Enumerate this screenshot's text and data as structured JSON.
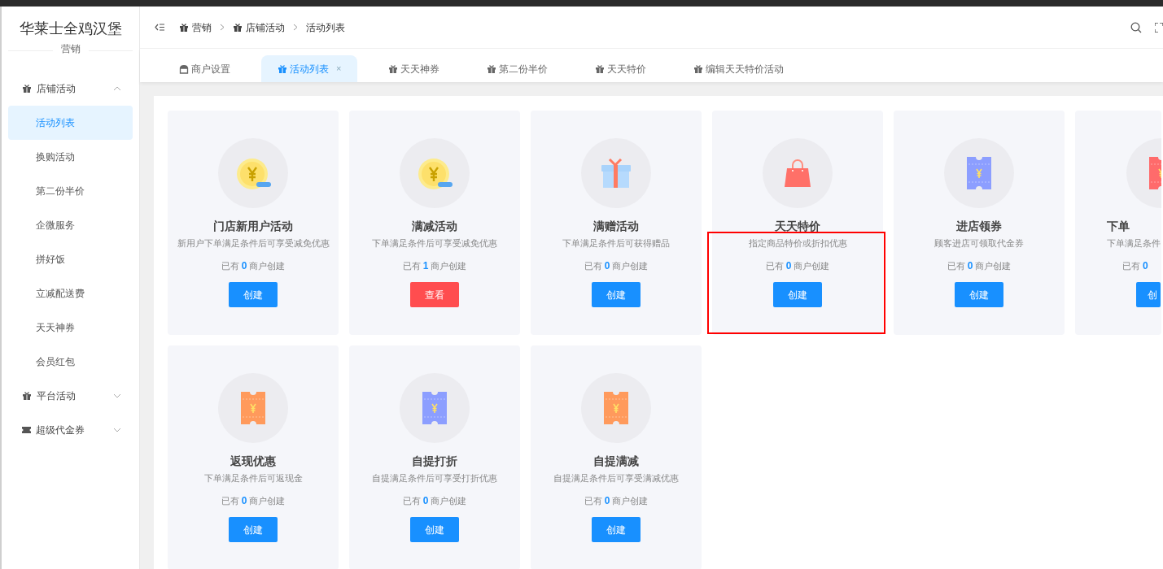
{
  "sidebar": {
    "logo": "华莱士全鸡汉堡",
    "section": "营销",
    "groups": [
      {
        "label": "店铺活动",
        "expanded": true,
        "items": [
          {
            "label": "活动列表",
            "selected": true
          },
          {
            "label": "换购活动",
            "selected": false
          },
          {
            "label": "第二份半价",
            "selected": false
          },
          {
            "label": "企微服务",
            "selected": false
          },
          {
            "label": "拼好饭",
            "selected": false
          },
          {
            "label": "立减配送费",
            "selected": false
          },
          {
            "label": "天天神券",
            "selected": false
          },
          {
            "label": "会员红包",
            "selected": false
          }
        ]
      },
      {
        "label": "平台活动",
        "expanded": false
      },
      {
        "label": "超级代金券",
        "expanded": false
      }
    ]
  },
  "breadcrumbs": [
    "营销",
    "店铺活动",
    "活动列表"
  ],
  "tabs": [
    {
      "label": "商户设置",
      "selected": false
    },
    {
      "label": "活动列表",
      "selected": true,
      "close": "×"
    },
    {
      "label": "天天神券",
      "selected": false
    },
    {
      "label": "第二份半价",
      "selected": false
    },
    {
      "label": "天天特价",
      "selected": false
    },
    {
      "label": "编辑天天特价活动",
      "selected": false
    }
  ],
  "cards": [
    {
      "kind": "coin",
      "title": "门店新用户活动",
      "description": "新用户下单满足条件后可享受减免优惠",
      "count_prefix": "已有",
      "count": "0",
      "count_suffix": "商户创建",
      "button": {
        "label": "创建",
        "kind": "primary"
      },
      "highlighted": false
    },
    {
      "kind": "coin",
      "title": "满减活动",
      "description": "下单满足条件后可享受减免优惠",
      "count_prefix": "已有",
      "count": "1",
      "count_suffix": "商户创建",
      "button": {
        "label": "查看",
        "kind": "danger"
      },
      "highlighted": false
    },
    {
      "kind": "gift",
      "title": "满赠活动",
      "description": "下单满足条件后可获得赠品",
      "count_prefix": "已有",
      "count": "0",
      "count_suffix": "商户创建",
      "button": {
        "label": "创建",
        "kind": "primary"
      },
      "highlighted": false
    },
    {
      "kind": "bag",
      "title": "天天特价",
      "description": "指定商品特价或折扣优惠",
      "count_prefix": "已有",
      "count": "0",
      "count_suffix": "商户创建",
      "button": {
        "label": "创建",
        "kind": "primary"
      },
      "highlighted": true
    },
    {
      "kind": "ticket",
      "color": "#8c9eff",
      "title": "进店领券",
      "description": "顾客进店可领取代金券",
      "count_prefix": "已有",
      "count": "0",
      "count_suffix": "商户创建",
      "button": {
        "label": "创建",
        "kind": "primary"
      },
      "highlighted": false
    },
    {
      "kind": "ticket",
      "color": "#ff6b6b",
      "cut": true,
      "title": "下单",
      "description": "下单满足条件",
      "count_prefix": "已有",
      "count": "0",
      "button": {
        "label": "创",
        "kind": "primary"
      },
      "highlighted": false
    },
    {
      "kind": "ticket",
      "color": "#ff9a5c",
      "title": "返现优惠",
      "description": "下单满足条件后可返现金",
      "count_prefix": "已有",
      "count": "0",
      "count_suffix": "商户创建",
      "button": {
        "label": "创建",
        "kind": "primary"
      },
      "highlighted": false
    },
    {
      "kind": "ticket",
      "color": "#8c9eff",
      "title": "自提打折",
      "description": "自提满足条件后可享受打折优惠",
      "count_prefix": "已有",
      "count": "0",
      "count_suffix": "商户创建",
      "button": {
        "label": "创建",
        "kind": "primary"
      },
      "highlighted": false
    },
    {
      "kind": "ticket",
      "color": "#ff9a5c",
      "title": "自提满减",
      "description": "自提满足条件后可享受满减优惠",
      "count_prefix": "已有",
      "count": "0",
      "count_suffix": "商户创建",
      "button": {
        "label": "创建",
        "kind": "primary"
      },
      "highlighted": false
    }
  ]
}
